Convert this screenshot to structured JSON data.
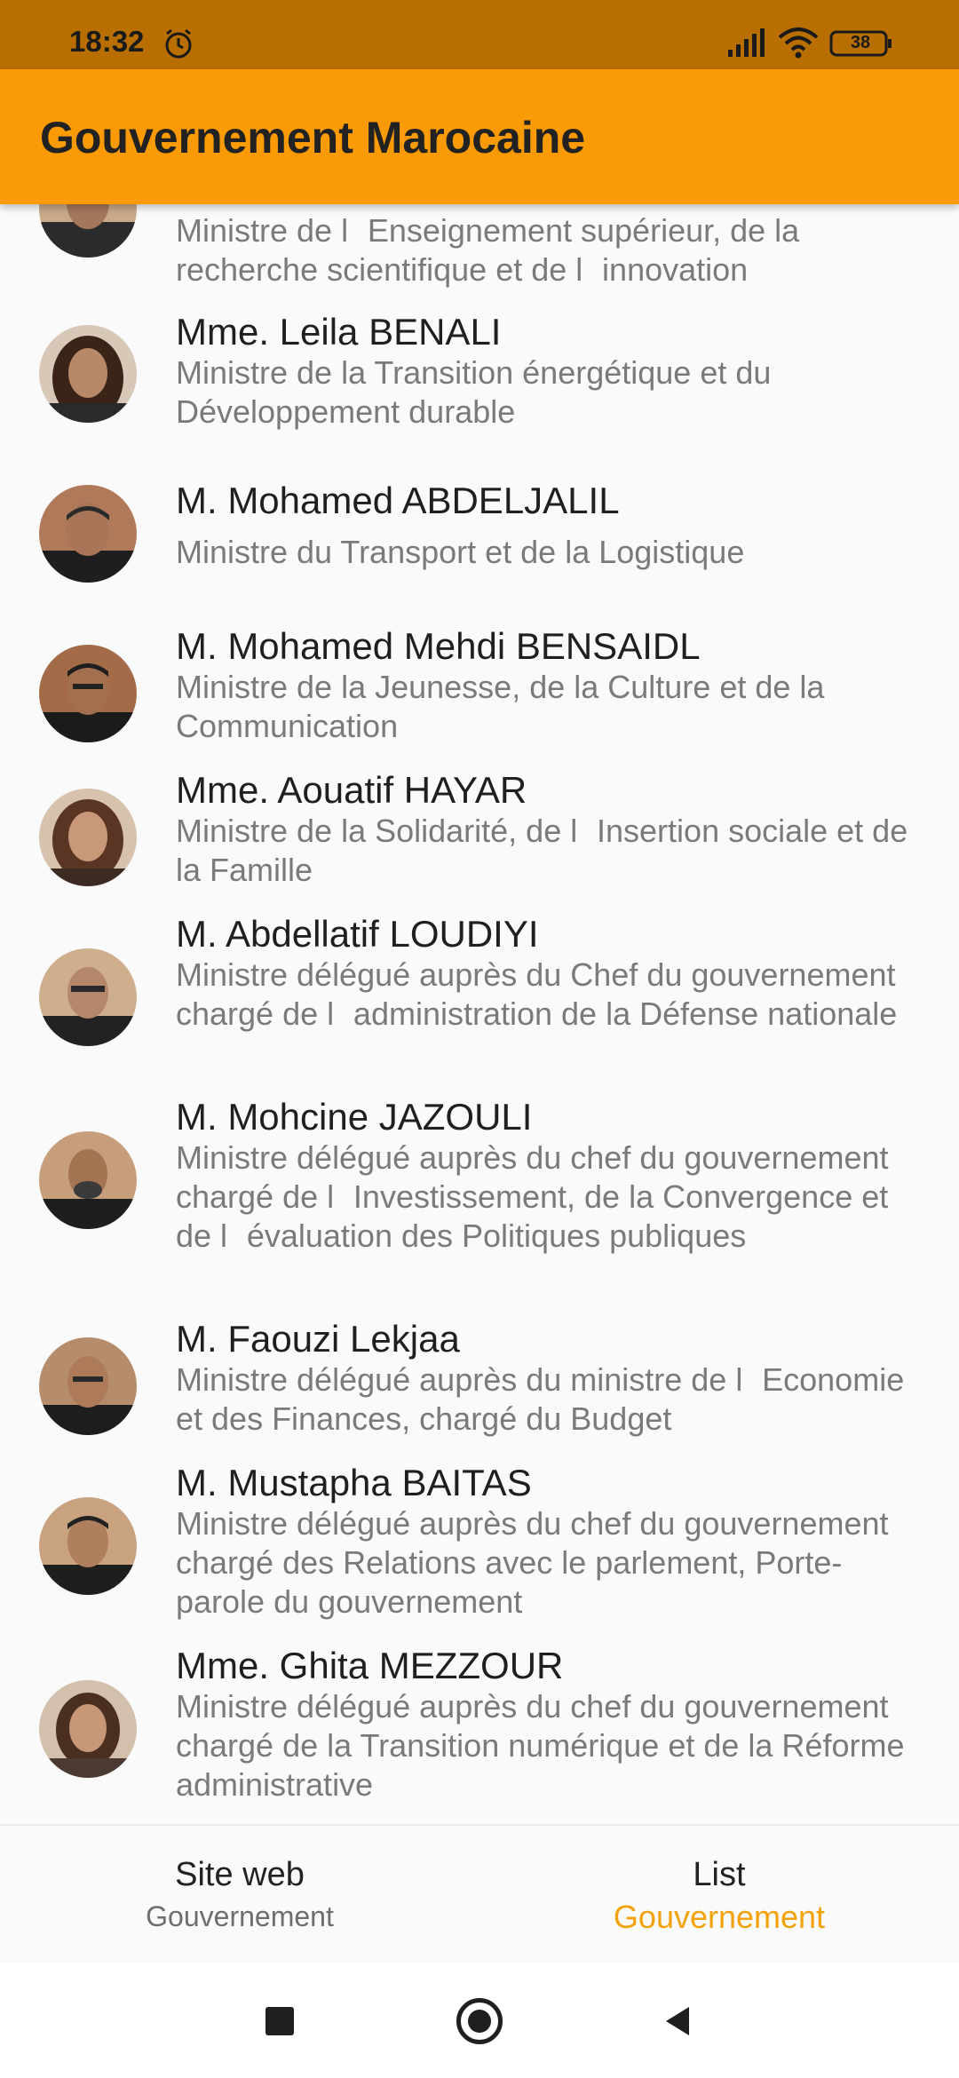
{
  "status_bar": {
    "time": "18:32",
    "battery": "38",
    "icons": [
      "alarm-icon",
      "signal-icon",
      "wifi-icon",
      "battery-icon"
    ]
  },
  "app_bar": {
    "title": "Gouvernement Marocaine"
  },
  "ministers": [
    {
      "name": "",
      "role": "Ministre de lEnseignement supérieur, de la recherche scientifique et de linnovation"
    },
    {
      "name": "Mme. Leila BENALI",
      "role": "Ministre de la Transition énergétique et du Développement durable"
    },
    {
      "name": "M. Mohamed ABDELJALIL",
      "role": "Ministre du Transport et de la Logistique"
    },
    {
      "name": "M. Mohamed Mehdi BENSAIDL",
      "role": "Ministre de la Jeunesse, de la Culture et de la Communication"
    },
    {
      "name": "Mme. Aouatif HAYAR",
      "role": "Ministre de la Solidarité, de lInsertion sociale et de la Famille"
    },
    {
      "name": "M. Abdellatif LOUDIYI",
      "role": "Ministre délégué auprès du Chef du gouvernement chargé de ladministration de la Défense nationale"
    },
    {
      "name": "M. Mohcine JAZOULI",
      "role": "Ministre délégué auprès du chef du gouvernement chargé de lInvestissement, de la Convergence et de lévaluation des Politiques publiques"
    },
    {
      "name": "M. Faouzi Lekjaa",
      "role": "Ministre délégué auprès du ministre de lEconomie et des Finances, chargé du Budget"
    },
    {
      "name": "M. Mustapha BAITAS",
      "role": "Ministre délégué auprès du chef du gouvernement chargé des Relations avec le parlement, Porte-parole du gouvernement"
    },
    {
      "name": "Mme. Ghita MEZZOUR",
      "role": "Ministre délégué auprès du chef du gouvernement chargé de la Transition numérique et de la Réforme administrative"
    }
  ],
  "bottom_nav": {
    "tabs": [
      {
        "label": "Site web",
        "sub": "Gouvernement",
        "active": false
      },
      {
        "label": "List",
        "sub": "Gouvernement",
        "active": true
      }
    ],
    "active_color": "#f2a20c"
  },
  "system_nav": {
    "buttons": [
      "recents-button",
      "home-button",
      "back-button"
    ]
  },
  "colors": {
    "app_bar": "#fa9a05",
    "status_bar": "#b96f00"
  }
}
